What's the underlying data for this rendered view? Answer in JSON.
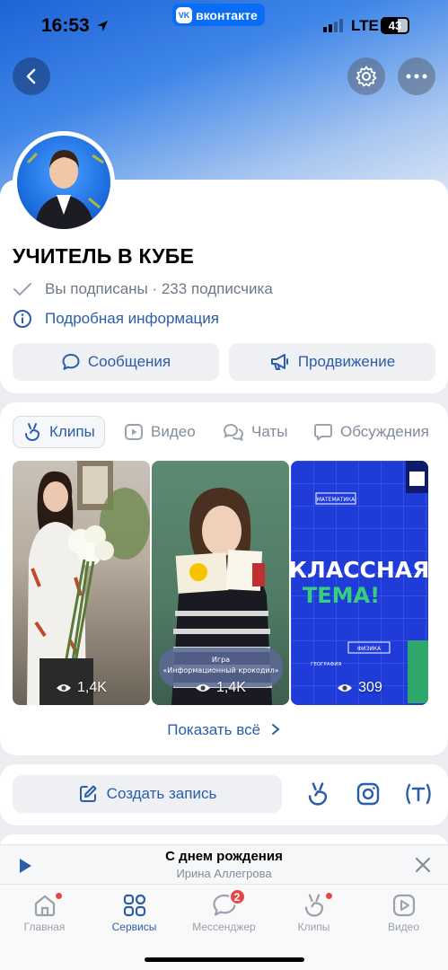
{
  "status_bar": {
    "time": "16:53",
    "network": "LTE",
    "battery": "43",
    "app_pill": "вконтакте"
  },
  "profile": {
    "name": "УЧИТЕЛЬ В КУБЕ",
    "subscription": "Вы подписаны · 233 подписчика",
    "details_link": "Подробная информация",
    "messages_label": "Сообщения",
    "promotion_label": "Продвижение"
  },
  "tabs": [
    {
      "label": "Клипы",
      "icon": "clips-icon"
    },
    {
      "label": "Видео",
      "icon": "video-icon"
    },
    {
      "label": "Чаты",
      "icon": "chats-icon"
    },
    {
      "label": "Обсуждения",
      "icon": "discussion-icon"
    }
  ],
  "clips": [
    {
      "views": "1,4K"
    },
    {
      "views": "1,4K",
      "caption_line1": "Игра",
      "caption_line2": "«Информационный крокодил»"
    },
    {
      "views": "309",
      "title_line1": "КЛАССНАЯ",
      "title_line2": "ТЕМА!",
      "tag1": "МАТЕМАТИКА",
      "tag2": "ФИЗИКА",
      "tag3": "ГЕОГРАФИЯ"
    }
  ],
  "show_all_label": "Показать всё",
  "create_post_label": "Создать запись",
  "player": {
    "title": "С днем рождения",
    "artist": "Ирина Аллегрова"
  },
  "nav": [
    {
      "label": "Главная",
      "icon": "home-icon",
      "dot": true
    },
    {
      "label": "Сервисы",
      "icon": "services-icon",
      "active": true
    },
    {
      "label": "Мессенджер",
      "icon": "messenger-icon",
      "badge": "2"
    },
    {
      "label": "Клипы",
      "icon": "clips-icon",
      "dot": true
    },
    {
      "label": "Видео",
      "icon": "video-icon"
    }
  ],
  "colors": {
    "accent": "#2a5ea8",
    "vk_blue": "#0a6df6",
    "badge_red": "#e64646"
  }
}
